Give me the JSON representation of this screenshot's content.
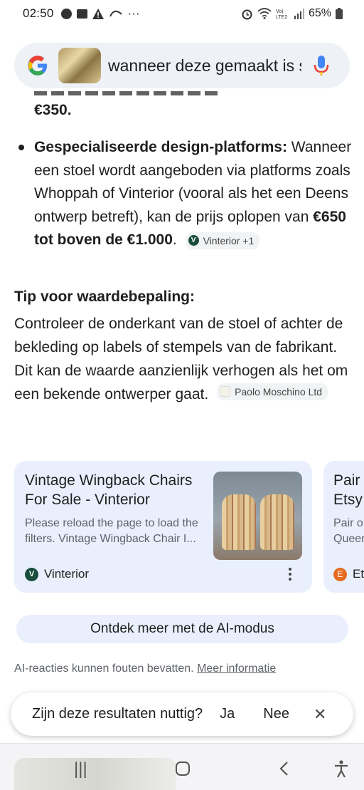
{
  "status_bar": {
    "time": "02:50",
    "dots": "···",
    "battery": "65%"
  },
  "search": {
    "query": "wanneer deze gemaakt is s"
  },
  "answer": {
    "price_top": "€350.",
    "bullet_title": "Gespecialiseerde design-platforms:",
    "bullet_text": " Wanneer een stoel wordt aangeboden via platforms zoals Whoppah of Vinterior (vooral als het een Deens ontwerp betreft), kan de prijs oplopen van ",
    "bullet_bold": "€650 tot boven de €1.000",
    "bullet_end": ".",
    "bullet_chip": "Vinterior +1",
    "tip_title": "Tip voor waardebepaling:",
    "tip_text": "Controleer de onderkant van de stoel of achter de bekleding op labels of stempels van de fabrikant. Dit kan de waarde aanzienlijk verhogen als het om een bekende ontwerper gaat.",
    "tip_chip": "Paolo Moschino Ltd"
  },
  "cards": [
    {
      "title": "Vintage Wingback Chairs For Sale - Vinterior",
      "desc": "Please reload the page to load the filters. Vintage Wingback Chair I...",
      "source": "Vinterior",
      "icon": "V"
    },
    {
      "title": "Pair",
      "title2": "Etsy",
      "desc": "Pair o",
      "desc2": "Queen",
      "source": "Et",
      "icon": "E"
    }
  ],
  "ai_mode_button": "Ontdek meer met de AI-modus",
  "disclaimer": "AI-reacties kunnen fouten bevatten.",
  "disclaimer_link": "Meer informatie",
  "feedback": {
    "question": "Zijn deze resultaten nuttig?",
    "yes": "Ja",
    "no": "Nee",
    "close": "✕"
  },
  "nav": {
    "recents": "|||",
    "home": "○",
    "back": "‹",
    "accessibility": "accessibility-icon"
  },
  "colors": {
    "card_bg": "#e9effd",
    "search_bg": "#eef1f6",
    "vinterior_icon": "#1a4d3c",
    "etsy_icon": "#e56b1f"
  }
}
